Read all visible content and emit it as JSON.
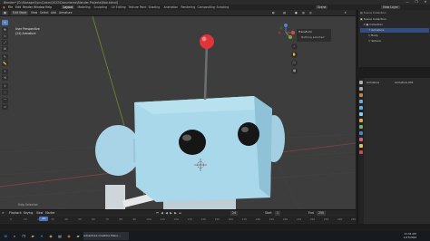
{
  "window": {
    "title": "Blender* [D:\\Storage\\Sync\\Learn\\2022\\Documents\\Blender Projects\\Bob.blend]",
    "controls": [
      "—",
      "❐",
      "✕"
    ]
  },
  "menubar": {
    "logo": "◉",
    "items": [
      "File",
      "Edit",
      "Render",
      "Window",
      "Help"
    ],
    "tabs": [
      {
        "label": "Layout",
        "active": true
      },
      {
        "label": "Modeling",
        "active": false
      },
      {
        "label": "Sculpting",
        "active": false
      },
      {
        "label": "UV Editing",
        "active": false
      },
      {
        "label": "Texture Paint",
        "active": false
      },
      {
        "label": "Shading",
        "active": false
      },
      {
        "label": "Animation",
        "active": false
      },
      {
        "label": "Rendering",
        "active": false
      },
      {
        "label": "Compositing",
        "active": false
      },
      {
        "label": "Scripting",
        "active": false
      }
    ],
    "scene": "Scene",
    "view_layer": "View Layer"
  },
  "viewport_header": {
    "mode": "Edit Mode",
    "menus": [
      "View",
      "Select",
      "Add",
      "Armature"
    ]
  },
  "viewport": {
    "info_line1": "User Perspective",
    "info_line2": "(24) Armature",
    "npanel_header": "Transform",
    "npanel_body": "Nothing selected",
    "status_hint": "Help Selected",
    "colors": {
      "bg": "#3d3d3d",
      "body": "#a8d8ea",
      "nose": "#c8d4da",
      "antenna_ball": "#e0333a"
    }
  },
  "tools": [
    "cursor-icon",
    "move-icon",
    "rotate-icon",
    "scale-icon",
    "transform-icon",
    "annotate-icon",
    "measure-icon",
    "extrude-icon",
    "roll-icon",
    "bone-size-icon",
    "envelope-icon",
    "bend-icon",
    "shear-icon"
  ],
  "timeline": {
    "menus": [
      "Playback",
      "Keying",
      "View",
      "Marker"
    ],
    "start_label": "Start",
    "start": "1",
    "end_label": "End",
    "end": "250",
    "current_frame": "24",
    "frame_numbers": [
      "0",
      "10",
      "20",
      "30",
      "40",
      "50",
      "60",
      "70",
      "80",
      "90",
      "100",
      "110",
      "120",
      "130",
      "140",
      "150",
      "160",
      "170",
      "180",
      "190",
      "200",
      "210",
      "220",
      "230",
      "240",
      "250"
    ]
  },
  "outliner": {
    "header": "Scene Collection",
    "rows": [
      {
        "label": "Scene Collection",
        "indent": 0,
        "selected": false
      },
      {
        "label": "Collection",
        "indent": 1,
        "selected": false
      },
      {
        "label": "Armature",
        "indent": 2,
        "selected": true
      },
      {
        "label": "Body",
        "indent": 2,
        "selected": false
      },
      {
        "label": "Sphere",
        "indent": 2,
        "selected": false
      }
    ]
  },
  "properties": {
    "breadcrumb_left": "Armature",
    "breadcrumb_right": "Armature.001",
    "icon_colors": [
      "#aaaaaa",
      "#aaaaaa",
      "#c7814a",
      "#7aa3d8",
      "#62b0e0",
      "#8fd0e8",
      "#e0a060",
      "#70b070",
      "#5080d0",
      "#d06080",
      "#e0c060",
      "#c05050"
    ]
  },
  "taskbar": {
    "items": [
      "windows-icon",
      "search-icon",
      "task-view-icon",
      "file-explorer-icon",
      "edge-icon",
      "chrome-icon",
      "store-icon",
      "blender-icon",
      "explorer-icon"
    ],
    "running_label": "Adventure Creative Manu...",
    "clock_time": "11:34 AM",
    "clock_date": "1/17/2022"
  }
}
